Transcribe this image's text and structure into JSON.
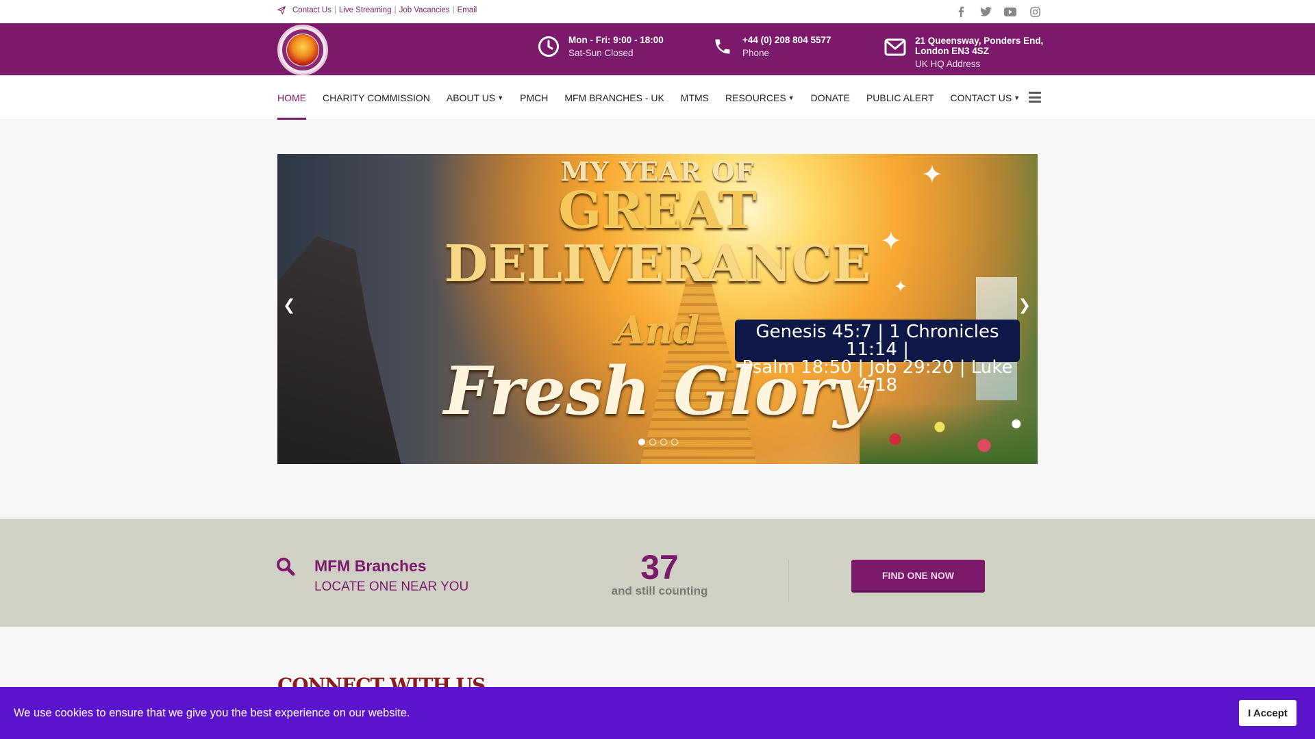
{
  "topbar": {
    "links": [
      "Contact Us",
      "Live Streaming",
      "Job Vacancies",
      "Email"
    ],
    "social_icons": [
      "facebook-icon",
      "twitter-icon",
      "youtube-icon",
      "instagram-icon"
    ]
  },
  "header": {
    "hours": {
      "line1": "Mon - Fri: 9:00 - 18:00",
      "line2": "Sat-Sun Closed"
    },
    "phone": {
      "line1": "+44 (0) 208 804 5577",
      "line2": "Phone"
    },
    "address": {
      "line1": "21 Queensway, Ponders End, London EN3 4SZ",
      "line2": "UK HQ Address"
    },
    "brand_color": "#7b1a6b"
  },
  "nav": {
    "items": [
      {
        "label": "HOME",
        "active": true
      },
      {
        "label": "CHARITY COMMISSION"
      },
      {
        "label": "ABOUT US",
        "dropdown": true
      },
      {
        "label": "PMCH"
      },
      {
        "label": "MFM BRANCHES - UK"
      },
      {
        "label": "MTMS"
      },
      {
        "label": "RESOURCES",
        "dropdown": true
      },
      {
        "label": "DONATE"
      },
      {
        "label": "PUBLIC ALERT"
      },
      {
        "label": "CONTACT US",
        "dropdown": true
      }
    ]
  },
  "slider": {
    "title_line1": "MY YEAR OF",
    "title_line2": "GREAT",
    "title_line3": "DELIVERANCE",
    "title_line4": "And",
    "title_line5": "Fresh Glory",
    "verse_line1": "Genesis 45:7 | 1 Chronicles 11:14 |",
    "verse_line2": "Psalm 18:50 | Job 29:20 | Luke 4:18",
    "active_slide": 1,
    "slide_count": 4
  },
  "branches": {
    "title": "MFM Branches",
    "subtitle": "LOCATE ONE NEAR YOU",
    "count": "37",
    "count_label": "and still counting",
    "button_label": "FIND ONE NOW"
  },
  "connect": {
    "heading": "CONNECT WITH US"
  },
  "cookie": {
    "message": "We use cookies to ensure that we give you the best experience on our website.",
    "accept_label": "I Accept",
    "bar_color": "#5b14cc"
  }
}
